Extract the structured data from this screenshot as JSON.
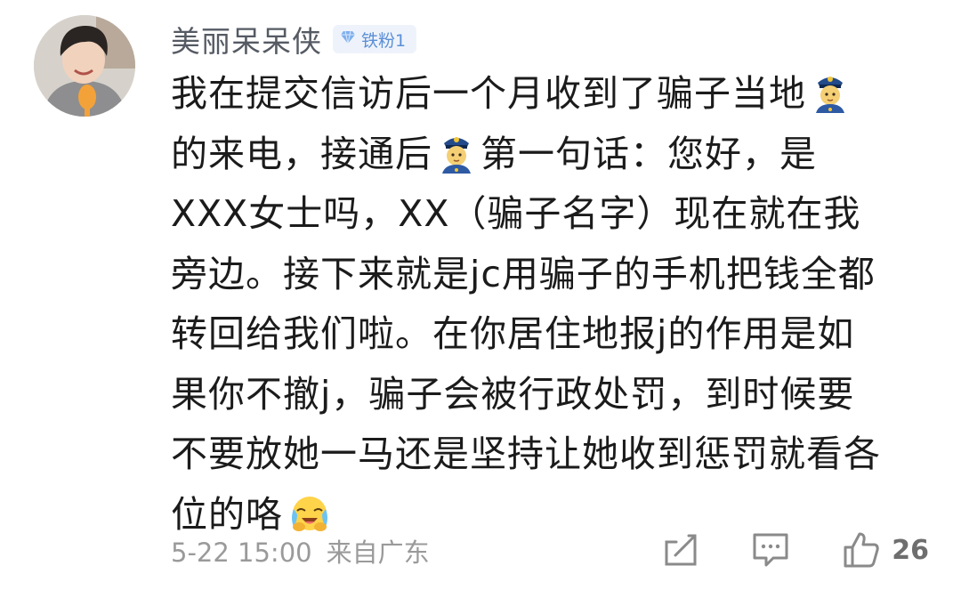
{
  "comment": {
    "author": "美丽呆呆侠",
    "badge": "铁粉1",
    "text_lines": [
      "我在提交信访后一个月收到了骗子当地",
      "的来电，接通后",
      "第一句话：您好，是",
      "XXX女士吗，XX（骗子名字）现在就在我",
      "旁边。接下来就是jc用骗子的手机把钱全都",
      "转回给我们啦。在你居住地报j的作用是如",
      "果你不撤j，骗子会被行政处罚，到时候要",
      "不要放她一马还是坚持让她收到惩罚就看各",
      "位的咯"
    ],
    "emojis": [
      "police-officer-emoji",
      "police-officer-emoji",
      "crying-laughing-emoji"
    ],
    "date": "5-22 15:00",
    "location": "来自广东",
    "like_count": "26"
  },
  "colors": {
    "username": "#555a63",
    "badge_text": "#5b8fd6",
    "badge_bg": "#eef3fb",
    "body_text": "#1b1b1b",
    "meta_text": "#9a9a9a"
  }
}
